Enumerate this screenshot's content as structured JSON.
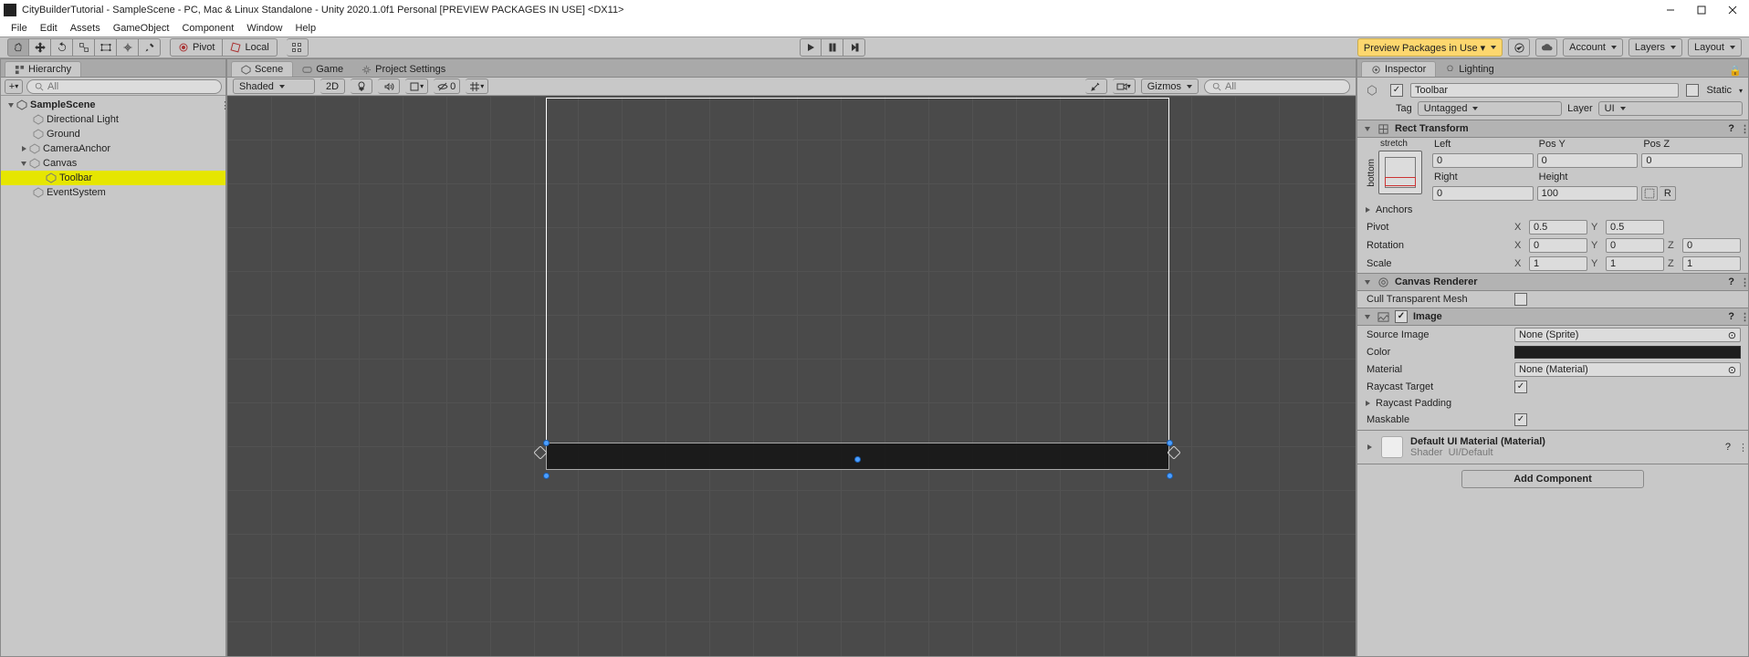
{
  "window": {
    "title": "CityBuilderTutorial - SampleScene - PC, Mac & Linux Standalone - Unity 2020.1.0f1 Personal [PREVIEW PACKAGES IN USE] <DX11>"
  },
  "menus": [
    "File",
    "Edit",
    "Assets",
    "GameObject",
    "Component",
    "Window",
    "Help"
  ],
  "toolbar": {
    "pivot": "Pivot",
    "local": "Local",
    "preview_packages": "Preview Packages in Use  ▾",
    "account": "Account",
    "layers": "Layers",
    "layout": "Layout"
  },
  "hierarchy": {
    "title": "Hierarchy",
    "search_placeholder": "All",
    "scene": "SampleScene",
    "items": [
      "Directional Light",
      "Ground",
      "CameraAnchor",
      "Canvas",
      "Toolbar",
      "EventSystem"
    ]
  },
  "center": {
    "tabs": {
      "scene": "Scene",
      "game": "Game",
      "project_settings": "Project Settings"
    },
    "shading": "Shaded",
    "mode2d": "2D",
    "gizmos": "Gizmos",
    "gizmo_scale": "0",
    "camera_search": "All"
  },
  "inspector": {
    "tabs": {
      "inspector": "Inspector",
      "lighting": "Lighting"
    },
    "name": "Toolbar",
    "static": "Static",
    "tag_label": "Tag",
    "tag_value": "Untagged",
    "layer_label": "Layer",
    "layer_value": "UI",
    "rect": {
      "title": "Rect Transform",
      "stretch": "stretch",
      "bottom": "bottom",
      "left": "Left",
      "left_v": "0",
      "posy": "Pos Y",
      "posy_v": "0",
      "posz": "Pos Z",
      "posz_v": "0",
      "right": "Right",
      "right_v": "0",
      "height": "Height",
      "height_v": "100",
      "anchors": "Anchors",
      "pivot": "Pivot",
      "pivot_x": "0.5",
      "pivot_y": "0.5",
      "rotation": "Rotation",
      "rx": "0",
      "ry": "0",
      "rz": "0",
      "scale": "Scale",
      "sx": "1",
      "sy": "1",
      "sz": "1",
      "r_btn": "R"
    },
    "canvas_renderer": {
      "title": "Canvas Renderer",
      "cull": "Cull Transparent Mesh"
    },
    "image": {
      "title": "Image",
      "source": "Source Image",
      "source_v": "None (Sprite)",
      "color": "Color",
      "material": "Material",
      "material_v": "None (Material)",
      "raycast": "Raycast Target",
      "raypad": "Raycast Padding",
      "maskable": "Maskable"
    },
    "material": {
      "title": "Default UI Material (Material)",
      "shader_l": "Shader",
      "shader_v": "UI/Default"
    },
    "add": "Add Component"
  }
}
